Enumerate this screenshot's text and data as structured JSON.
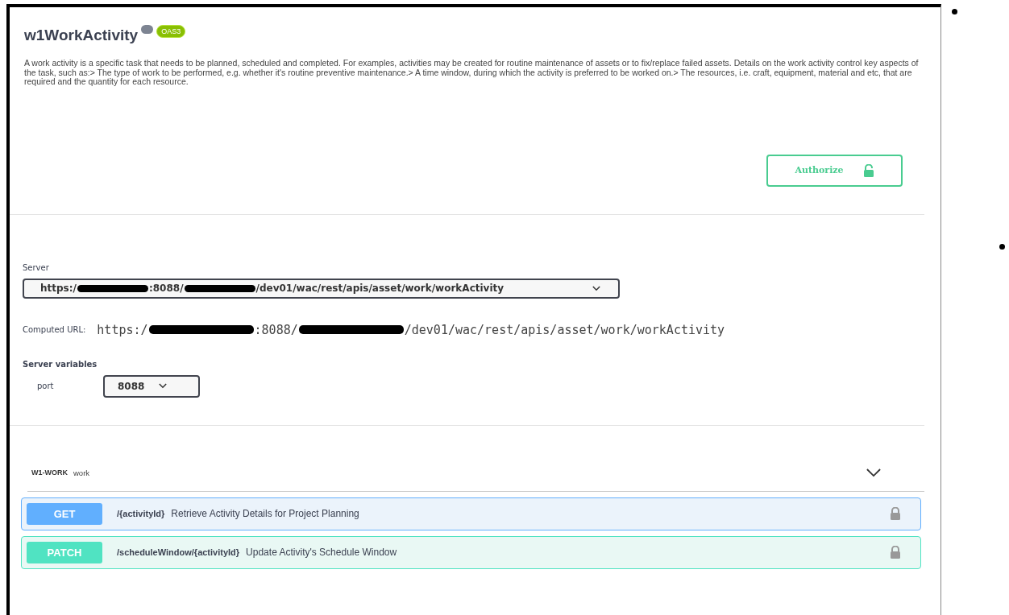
{
  "info": {
    "title": "w1WorkActivity",
    "badges": [
      {
        "kind": "version"
      },
      {
        "kind": "spec",
        "label": "OAS3"
      }
    ],
    "description": "A work activity is a specific task that needs to be planned, scheduled and completed. For examples, activities may be created for routine maintenance of assets or to fix/replace failed assets. Details on the work activity control key aspects of the task, such as:> The type of work to be performed, e.g. whether it's routine preventive maintenance.> A time window, during which the activity is preferred to be worked on.> The resources, i.e. craft, equipment, material and etc, that are required and the quantity for each resource."
  },
  "authorize_button": {
    "label": "Authorize"
  },
  "server": {
    "label": "Server",
    "value": [
      {
        "kind": "text",
        "text": "https:/"
      },
      {
        "kind": "redacted"
      },
      {
        "kind": "text",
        "text": ":8088/"
      },
      {
        "kind": "redacted"
      },
      {
        "kind": "text",
        "text": "/dev01/wac/rest/apis/asset/work/workActivity"
      }
    ]
  },
  "computed_url": {
    "label": "Computed URL:",
    "value": [
      {
        "kind": "text",
        "text": "https:/"
      },
      {
        "kind": "redacted"
      },
      {
        "kind": "text",
        "text": ":8088/"
      },
      {
        "kind": "redacted"
      },
      {
        "kind": "text",
        "text": "/dev01/wac/rest/apis/asset/work/workActivity"
      }
    ]
  },
  "server_variables": {
    "label": "Server variables",
    "variables": [
      {
        "name": "port",
        "value": "8088"
      }
    ]
  },
  "tag": {
    "name": "W1-WORK",
    "description": "work",
    "expanded": true,
    "operations": [
      {
        "method": "GET",
        "path": "/{activityId}",
        "summary": "Retrieve Activity Details for Project Planning"
      },
      {
        "method": "PATCH",
        "path": "/scheduleWindow/{activityId}",
        "summary": "Update Activity's Schedule Window"
      }
    ]
  }
}
